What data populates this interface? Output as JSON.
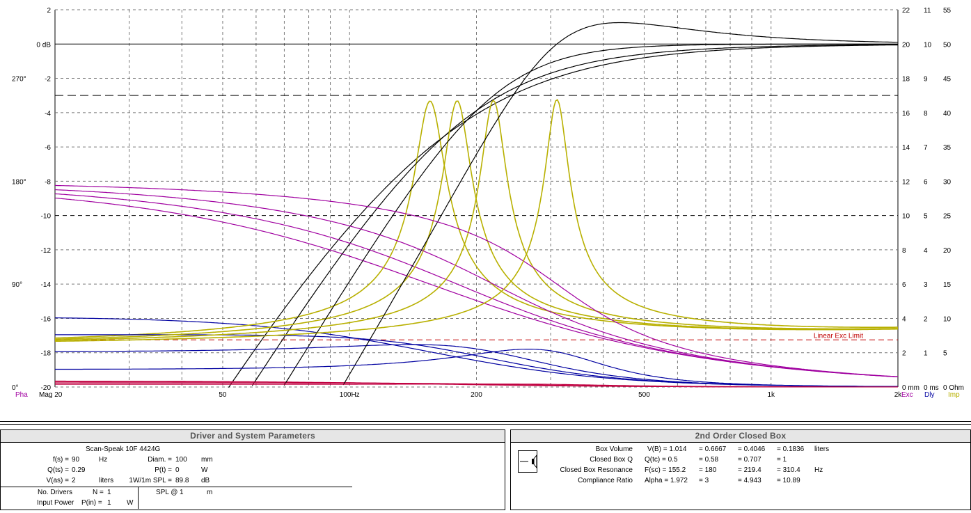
{
  "chart_data": {
    "type": "line",
    "x_scale": "log",
    "x_range": [
      20,
      2000
    ],
    "x_tick_labels": [
      {
        "value": 20,
        "label": "Mag 20"
      },
      {
        "value": 50,
        "label": "50"
      },
      {
        "value": 100,
        "label": "100Hz"
      },
      {
        "value": 200,
        "label": "200"
      },
      {
        "value": 500,
        "label": "500"
      },
      {
        "value": 1000,
        "label": "1k"
      },
      {
        "value": 2000,
        "label": "2k"
      }
    ],
    "y_range_db": [
      -20,
      2
    ],
    "y_tick_labels": [
      "2",
      "0 dB",
      "-2",
      "-4",
      "-6",
      "-8",
      "-10",
      "-12",
      "-14",
      "-16",
      "-18",
      "-20"
    ],
    "phase_labels": [
      {
        "db": -2,
        "label": "270°"
      },
      {
        "db": -8,
        "label": "180°"
      },
      {
        "db": -14,
        "label": "90°"
      },
      {
        "db": -20,
        "label": "0°"
      }
    ],
    "right_axis_1": [
      "22",
      "20",
      "18",
      "16",
      "14",
      "12",
      "10",
      "8",
      "6",
      "4",
      "2",
      "0 mm"
    ],
    "right_axis_2": [
      "11",
      "10",
      "9",
      "8",
      "7",
      "6",
      "5",
      "4",
      "3",
      "2",
      "1",
      "0 ms"
    ],
    "right_axis_3": [
      "55",
      "50",
      "45",
      "40",
      "35",
      "30",
      "25",
      "20",
      "15",
      "10",
      "5",
      "0 Ohm"
    ],
    "bottom_labels": {
      "pha": "Pha",
      "exc": "Exc",
      "dly": "Dly",
      "imp": "Imp"
    },
    "annotation": "Linear Exc Limit",
    "grid": true,
    "colors": {
      "magnitude": "#000000",
      "phase": "#a000a0",
      "delay": "#0000a0",
      "excursion": "#c00040",
      "impedance": "#b8b000",
      "limit": "#c00000"
    },
    "fc": [
      155.2,
      180,
      219.4,
      310.4
    ],
    "qtc": [
      0.5,
      0.58,
      0.707,
      1
    ],
    "impedance_peak_ohm": 41.2,
    "excursion_limit_mm": 2.75
  },
  "driver_panel": {
    "title": "Driver and System Parameters",
    "driver_name": "Scan-Speak  10F 4424G",
    "fs_label": "f(s) =",
    "fs_value": "90",
    "fs_unit": "Hz",
    "qts_label": "Q(ts) =",
    "qts_value": "0.29",
    "vas_label": "V(as) =",
    "vas_value": "2",
    "vas_unit": "liters",
    "diam_label": "Diam. =",
    "diam_value": "100",
    "diam_unit": "mm",
    "pt_label": "P(t) =",
    "pt_value": "0",
    "pt_unit": "W",
    "spl_label": "1W/1m SPL =",
    "spl_value": "89.8",
    "spl_unit": "dB",
    "ndrivers_label": "No. Drivers",
    "ndrivers_sym": "N =",
    "ndrivers_value": "1",
    "power_label": "Input Power",
    "power_sym": "P(in) =",
    "power_value": "1",
    "power_unit": "W",
    "splat_label": "SPL @",
    "splat_value": "1",
    "splat_unit": "m"
  },
  "box_panel": {
    "title": "2nd Order Closed Box",
    "vb_label": "Box Volume",
    "vb_sym": "V(B) = 1.014",
    "vb_2": "= 0.6667",
    "vb_3": "= 0.4046",
    "vb_4": "= 0.1836",
    "vb_unit": "liters",
    "qtc_label": "Closed Box Q",
    "qtc_sym": "Q(tc) = 0.5",
    "qtc_2": "= 0.58",
    "qtc_3": "= 0.707",
    "qtc_4": "= 1",
    "fsc_label": "Closed Box Resonance",
    "fsc_sym": "F(sc) = 155.2",
    "fsc_2": "= 180",
    "fsc_3": "= 219.4",
    "fsc_4": "= 310.4",
    "fsc_unit": "Hz",
    "alpha_label": "Compliance Ratio",
    "alpha_sym": "Alpha = 1.972",
    "alpha_2": "= 3",
    "alpha_3": "= 4.943",
    "alpha_4": "= 10.89"
  }
}
